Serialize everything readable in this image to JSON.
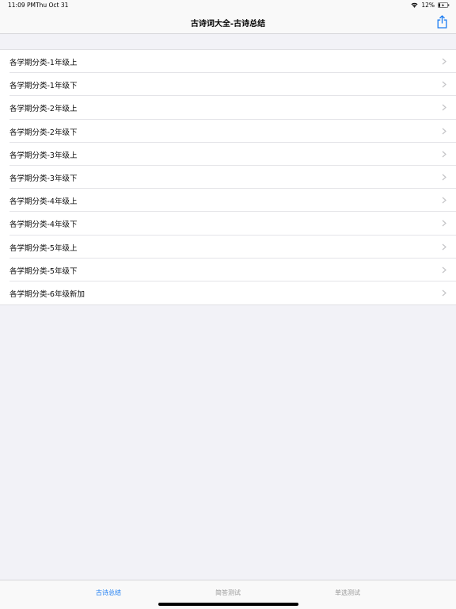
{
  "status_bar": {
    "time": "11:09 PM",
    "date": "Thu Oct 31",
    "battery": "12%"
  },
  "nav": {
    "title": "古诗词大全-古诗总结",
    "share_icon": "share-icon"
  },
  "list": {
    "items": [
      {
        "label": "各学期分类-1年级上"
      },
      {
        "label": "各学期分类-1年级下"
      },
      {
        "label": "各学期分类-2年级上"
      },
      {
        "label": "各学期分类-2年级下"
      },
      {
        "label": "各学期分类-3年级上"
      },
      {
        "label": "各学期分类-3年级下"
      },
      {
        "label": "各学期分类-4年级上"
      },
      {
        "label": "各学期分类-4年级下"
      },
      {
        "label": "各学期分类-5年级上"
      },
      {
        "label": "各学期分类-5年级下"
      },
      {
        "label": "各学期分类-6年级新加"
      }
    ]
  },
  "tabs": [
    {
      "label": "古诗总结",
      "active": true
    },
    {
      "label": "简答测试",
      "active": false
    },
    {
      "label": "单选测试",
      "active": false
    }
  ],
  "colors": {
    "accent": "#1a7cf2",
    "background": "#f2f2f7"
  }
}
